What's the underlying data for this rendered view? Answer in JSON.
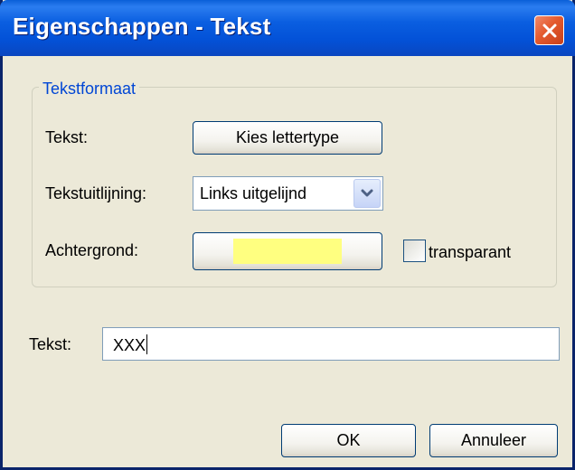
{
  "window": {
    "title": "Eigenschappen - Tekst"
  },
  "group": {
    "legend": "Tekstformaat",
    "text_label": "Tekst:",
    "font_button_label": "Kies lettertype",
    "align_label": "Tekstuitlijning:",
    "align_selected": "Links uitgelijnd",
    "background_label": "Achtergrond:",
    "background_color": "#ffff80",
    "transparent_label": "transparant",
    "transparent_checked": false
  },
  "text_field": {
    "label": "Tekst:",
    "value": "XXX"
  },
  "buttons": {
    "ok": "OK",
    "cancel": "Annuleer"
  },
  "icons": {
    "close": "close-icon",
    "dropdown": "chevron-down-icon"
  },
  "colors": {
    "titlebar": "#0a5ee0",
    "legend": "#0046d5",
    "window_bg": "#ece9d8",
    "close_button": "#e45a2e"
  }
}
